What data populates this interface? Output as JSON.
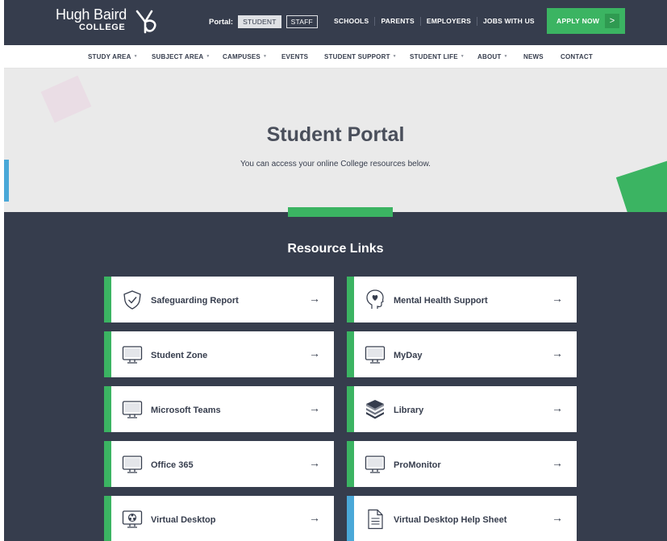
{
  "header": {
    "logo_name": "Hugh Baird",
    "logo_sub": "COLLEGE",
    "portal_label": "Portal:",
    "portal_options": [
      "STUDENT",
      "STAFF"
    ],
    "top_links": [
      "SCHOOLS",
      "PARENTS",
      "EMPLOYERS",
      "JOBS WITH US"
    ],
    "apply_label": "APPLY NOW",
    "apply_chevron": ">"
  },
  "nav": {
    "items": [
      {
        "label": "STUDY AREA",
        "dropdown": true
      },
      {
        "label": "SUBJECT AREA",
        "dropdown": true
      },
      {
        "label": "CAMPUSES",
        "dropdown": true
      },
      {
        "label": "EVENTS",
        "dropdown": false
      },
      {
        "label": "STUDENT SUPPORT",
        "dropdown": true
      },
      {
        "label": "STUDENT LIFE",
        "dropdown": true
      },
      {
        "label": "ABOUT",
        "dropdown": true
      },
      {
        "label": "NEWS",
        "dropdown": false
      },
      {
        "label": "CONTACT",
        "dropdown": false
      }
    ]
  },
  "hero": {
    "title": "Student Portal",
    "subtitle": "You can access your online College resources below."
  },
  "resources": {
    "title": "Resource Links",
    "arrow": "→",
    "cards": [
      {
        "label": "Safeguarding Report",
        "icon": "shield-check-icon",
        "accent": "#3bb462"
      },
      {
        "label": "Mental Health Support",
        "icon": "head-heart-icon",
        "accent": "#3bb462"
      },
      {
        "label": "Student Zone",
        "icon": "monitor-icon",
        "accent": "#3bb462"
      },
      {
        "label": "MyDay",
        "icon": "monitor-icon",
        "accent": "#3bb462"
      },
      {
        "label": "Microsoft Teams",
        "icon": "monitor-icon",
        "accent": "#3bb462"
      },
      {
        "label": "Library",
        "icon": "books-icon",
        "accent": "#3bb462"
      },
      {
        "label": "Office 365",
        "icon": "monitor-icon",
        "accent": "#3bb462"
      },
      {
        "label": "ProMonitor",
        "icon": "monitor-icon",
        "accent": "#3bb462"
      },
      {
        "label": "Virtual Desktop",
        "icon": "virtual-desktop-icon",
        "accent": "#3bb462"
      },
      {
        "label": "Virtual Desktop Help Sheet",
        "icon": "document-icon",
        "accent": "#4aa8d8"
      }
    ]
  },
  "colors": {
    "navy": "#363d4d",
    "green": "#3bb462",
    "blue": "#4aa8d8",
    "hero_bg": "#eaeaea"
  }
}
